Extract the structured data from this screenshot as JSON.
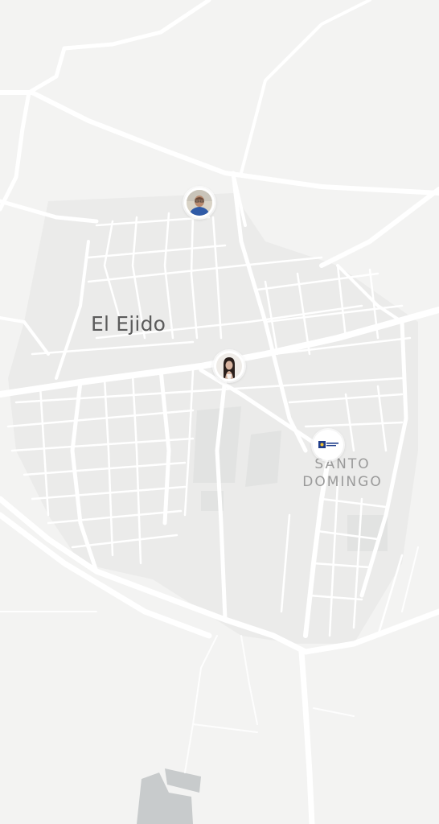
{
  "map": {
    "labels": {
      "city": "El Ejido",
      "district_line1": "SANTO",
      "district_line2": "DOMINGO"
    },
    "colors": {
      "land": "#f3f3f2",
      "road": "#ffffff",
      "block": "#ebebea",
      "park": "#e3e4e3",
      "industrial": "#c9cbcc"
    },
    "pins": [
      {
        "kind": "user-avatar",
        "subject": "man with glasses, blue shirt"
      },
      {
        "kind": "user-avatar",
        "subject": "woman with dark hair"
      },
      {
        "kind": "business-logo",
        "subject": "navy flag-style logo"
      }
    ]
  }
}
